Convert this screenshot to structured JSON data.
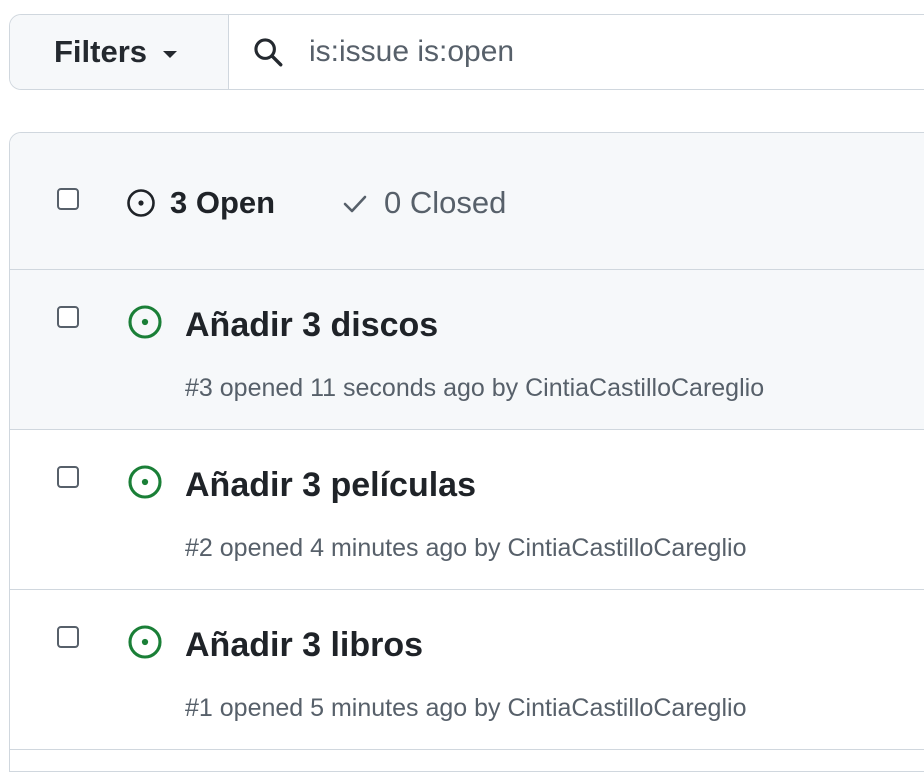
{
  "filter_bar": {
    "filters_label": "Filters",
    "search_value": "is:issue is:open"
  },
  "issues_header": {
    "open_label": "3 Open",
    "closed_label": "0 Closed"
  },
  "issues": [
    {
      "title": "Añadir 3 discos",
      "number": "#3",
      "opened": "opened 11 seconds ago by",
      "author": "CintiaCastilloCareglio"
    },
    {
      "title": "Añadir 3 películas",
      "number": "#2",
      "opened": "opened 4 minutes ago by",
      "author": "CintiaCastilloCareglio"
    },
    {
      "title": "Añadir 3 libros",
      "number": "#1",
      "opened": "opened 5 minutes ago by",
      "author": "CintiaCastilloCareglio"
    }
  ],
  "colors": {
    "open_green": "#1a7f37",
    "border": "#d0d7de",
    "header_bg": "#f6f8fa",
    "muted_text": "#57606a"
  }
}
